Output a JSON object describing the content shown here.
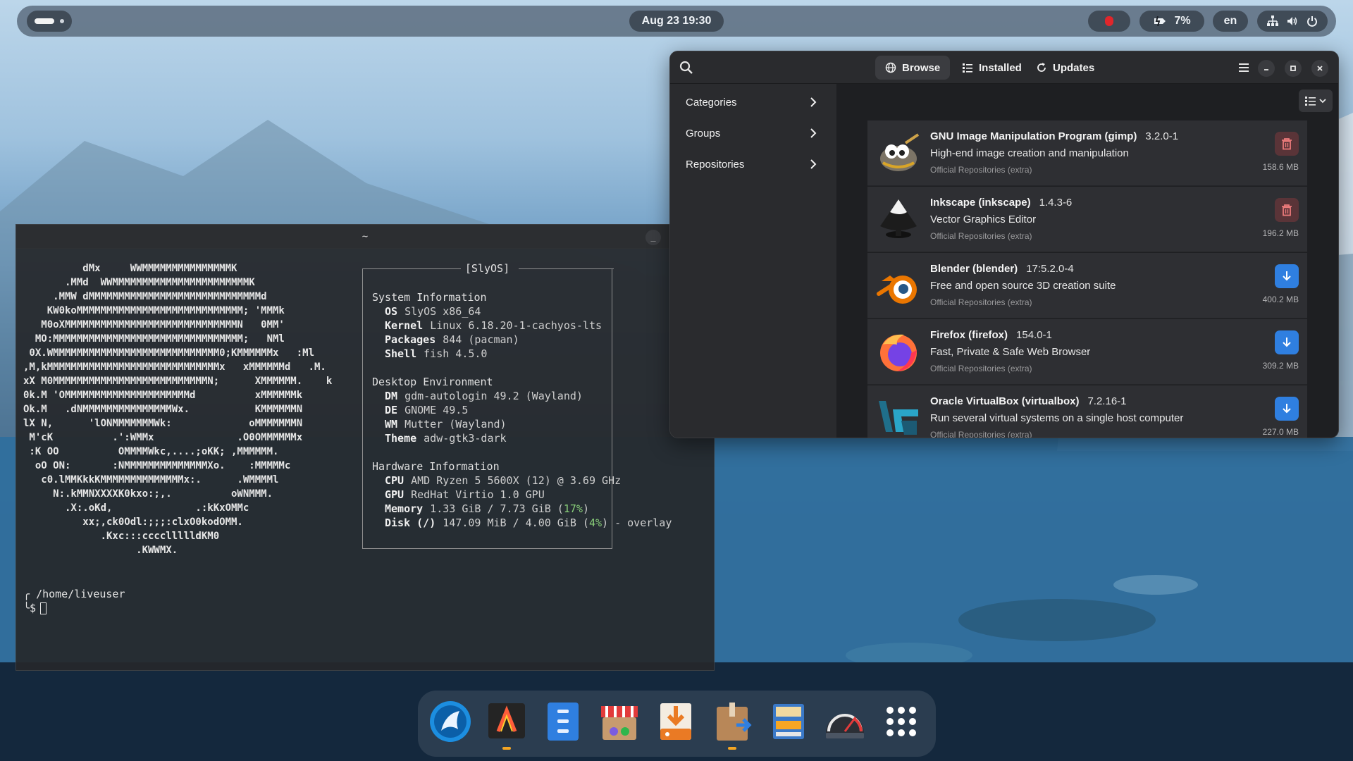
{
  "topbar": {
    "clock": "Aug 23  19:30",
    "battery_percent": "7%",
    "language": "en",
    "icons": [
      "activities-indicator",
      "record-icon",
      "battery-icon",
      "network-icon",
      "volume-icon",
      "power-icon"
    ]
  },
  "terminal": {
    "title": "~",
    "ascii_art": "          dMx     WWMMMMMMMMMMMMMMMK\n       .MMd  WWMMMMMMMMMMMMMMMMMMMMMMMK\n     .MMW dMMMMMMMMMMMMMMMMMMMMMMMMMMMMMd\n    KW0koMMMMMMMMMMMMMMMMMMMMMMMMMMMM; 'MMMk\n   M0oXMMMMMMMMMMMMMMMMMMMMMMMMMMMMMN   0MM'\n  MO:MMMMMMMMMMMMMMMMMMMMMMMMMMMMMMMM;   NMl\n 0X.WMMMMMMMMMMMMMMMMMMMMMMMMMMMM0;KMMMMMMx   :Ml\n,M,kMMMMMMMMMMMMMMMMMMMMMMMMMMMMMx   xMMMMMMd   .M.\nxX M0MMMMMMMMMMMMMMMMMMMMMMMMMMN;      XMMMMMM.    k\n0k.M 'OMMMMMMMMMMMMMMMMMMMMMd          xMMMMMMk\nOk.M   .dNMMMMMMMMMMMMMMMWx.           KMMMMMMN\nlX N,      'lONMMMMMMMWk:             oMMMMMMMN\n M'cK          .':WMMx              .O0OMMMMMMx\n :K OO          OMMMMWkc,....;oKK; ,MMMMMM.\n  oO ON:       :NMMMMMMMMMMMMMMXo.    :MMMMMc\n   c0.lMMKkkKMMMMMMMMMMMMMMx:.      .WMMMMl\n     N:.kMMNXXXXK0kxo:;,.          oWNMMM.\n       .X:.oKd,              .:kKxOMMc\n          xx;,ck0Odl:;;;:clxO0kodOMM.\n             .Kxc:::ccccllllldKM0\n                   .KWWMX.",
    "fastfetch_title": "[SlyOS]",
    "sections": [
      {
        "heading": "System Information",
        "rows": [
          {
            "key": "OS",
            "value": "SlyOS x86_64"
          },
          {
            "key": "Kernel",
            "value": "Linux 6.18.20-1-cachyos-lts"
          },
          {
            "key": "Packages",
            "value": "844 (pacman)"
          },
          {
            "key": "Shell",
            "value": "fish 4.5.0"
          }
        ]
      },
      {
        "heading": "Desktop Environment",
        "rows": [
          {
            "key": "DM",
            "value": "gdm-autologin 49.2 (Wayland)"
          },
          {
            "key": "DE",
            "value": "GNOME 49.5"
          },
          {
            "key": "WM",
            "value": "Mutter (Wayland)"
          },
          {
            "key": "Theme",
            "value": "adw-gtk3-dark"
          }
        ]
      },
      {
        "heading": "Hardware Information",
        "rows": [
          {
            "key": "CPU",
            "value": "AMD Ryzen 5 5600X (12) @ 3.69 GHz"
          },
          {
            "key": "GPU",
            "value": "RedHat Virtio 1.0 GPU"
          },
          {
            "key": "Memory",
            "value": "1.33 GiB / 7.73 GiB (",
            "highlight": "17%",
            "suffix": ")"
          },
          {
            "key": "Disk (/)",
            "value": "147.09 MiB / 4.00 GiB (",
            "highlight": "4%",
            "suffix": ") - overlay"
          }
        ]
      }
    ],
    "prompt_path": "/home/liveuser",
    "prompt_symbol": "$"
  },
  "store": {
    "tabs": [
      {
        "label": "Browse",
        "icon": "globe-icon",
        "active": true
      },
      {
        "label": "Installed",
        "icon": "list-icon",
        "active": false
      },
      {
        "label": "Updates",
        "icon": "refresh-icon",
        "active": false
      }
    ],
    "sidebar": [
      {
        "label": "Categories"
      },
      {
        "label": "Groups"
      },
      {
        "label": "Repositories"
      }
    ],
    "packages": [
      {
        "name": "GNU Image Manipulation Program (gimp)",
        "version": "3.2.0-1",
        "description": "High-end image creation and manipulation",
        "repo": "Official Repositories (extra)",
        "size": "158.6 MB",
        "action": "remove",
        "icon": "gimp-icon"
      },
      {
        "name": "Inkscape (inkscape)",
        "version": "1.4.3-6",
        "description": "Vector Graphics Editor",
        "repo": "Official Repositories (extra)",
        "size": "196.2 MB",
        "action": "remove",
        "icon": "inkscape-icon"
      },
      {
        "name": "Blender (blender)",
        "version": "17:5.2.0-4",
        "description": "Free and open source 3D creation suite",
        "repo": "Official Repositories (extra)",
        "size": "400.2 MB",
        "action": "install",
        "icon": "blender-icon"
      },
      {
        "name": "Firefox (firefox)",
        "version": "154.0-1",
        "description": "Fast, Private & Safe Web Browser",
        "repo": "Official Repositories (extra)",
        "size": "309.2 MB",
        "action": "install",
        "icon": "firefox-icon"
      },
      {
        "name": "Oracle VirtualBox (virtualbox)",
        "version": "7.2.16-1",
        "description": "Run several virtual systems on a single host computer",
        "repo": "Official Repositories (extra)",
        "size": "227.0 MB",
        "action": "install",
        "icon": "virtualbox-icon"
      }
    ]
  },
  "dock": [
    {
      "name": "browser",
      "icon": "wolf-browser-icon"
    },
    {
      "name": "terminal",
      "icon": "terminal-icon",
      "running": true
    },
    {
      "name": "files",
      "icon": "files-icon"
    },
    {
      "name": "software-store",
      "icon": "store-icon"
    },
    {
      "name": "installer",
      "icon": "installer-icon"
    },
    {
      "name": "package-manager",
      "icon": "package-icon",
      "running": true
    },
    {
      "name": "archive",
      "icon": "archive-icon"
    },
    {
      "name": "system-monitor",
      "icon": "gauge-icon"
    },
    {
      "name": "app-grid",
      "icon": "app-grid-icon"
    }
  ]
}
